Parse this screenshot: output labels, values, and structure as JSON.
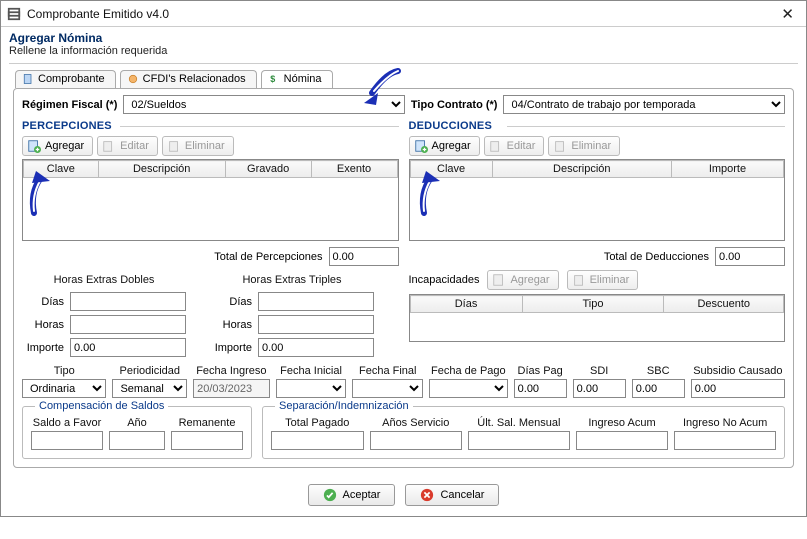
{
  "window": {
    "title": "Comprobante Emitido v4.0"
  },
  "subheader": {
    "heading": "Agregar Nómina",
    "subtext": "Rellene la información requerida"
  },
  "tabs": {
    "t1": "Comprobante",
    "t2": "CFDI's Relacionados",
    "t3": "Nómina"
  },
  "regimen": {
    "label": "Régimen Fiscal (*)",
    "value": "02/Sueldos"
  },
  "contrato": {
    "label": "Tipo Contrato (*)",
    "value": "04/Contrato de trabajo por temporada"
  },
  "percepciones": {
    "title": "PERCEPCIONES",
    "agregar": "Agregar",
    "editar": "Editar",
    "eliminar": "Eliminar",
    "cols": {
      "clave": "Clave",
      "desc": "Descripción",
      "grav": "Gravado",
      "exen": "Exento"
    },
    "total_label": "Total de Percepciones",
    "total_value": "0.00"
  },
  "deducciones": {
    "title": "DEDUCCIONES",
    "agregar": "Agregar",
    "editar": "Editar",
    "eliminar": "Eliminar",
    "cols": {
      "clave": "Clave",
      "desc": "Descripción",
      "imp": "Importe"
    },
    "total_label": "Total de Deducciones",
    "total_value": "0.00"
  },
  "extras": {
    "dobles_title": "Horas Extras Dobles",
    "triples_title": "Horas Extras Triples",
    "dias": "Días",
    "horas": "Horas",
    "importe": "Importe",
    "dobles_importe": "0.00",
    "triples_importe": "0.00"
  },
  "incap": {
    "title": "Incapacidades",
    "agregar": "Agregar",
    "eliminar": "Eliminar",
    "cols": {
      "dias": "Días",
      "tipo": "Tipo",
      "desc": "Descuento"
    }
  },
  "filarow": {
    "tipo_l": "Tipo",
    "period_l": "Periodicidad",
    "fing_l": "Fecha Ingreso",
    "fini_l": "Fecha Inicial",
    "ffin_l": "Fecha Final",
    "fpago_l": "Fecha de Pago",
    "diasp_l": "Días Pag",
    "sdi_l": "SDI",
    "sbc_l": "SBC",
    "subc_l": "Subsidio Causado",
    "tipo_v": "Ordinaria",
    "period_v": "Semanal",
    "fing_v": "20/03/2023",
    "diasp_v": "0.00",
    "sdi_v": "0.00",
    "sbc_v": "0.00",
    "subc_v": "0.00"
  },
  "comp": {
    "legend": "Compensación de Saldos",
    "saldo_l": "Saldo a Favor",
    "anio_l": "Año",
    "rem_l": "Remanente"
  },
  "sep": {
    "legend": "Separación/Indemnización",
    "tp_l": "Total Pagado",
    "as_l": "Años Servicio",
    "usm_l": "Últ. Sal. Mensual",
    "ia_l": "Ingreso Acum",
    "ina_l": "Ingreso No Acum"
  },
  "footer": {
    "aceptar": "Aceptar",
    "cancelar": "Cancelar"
  }
}
